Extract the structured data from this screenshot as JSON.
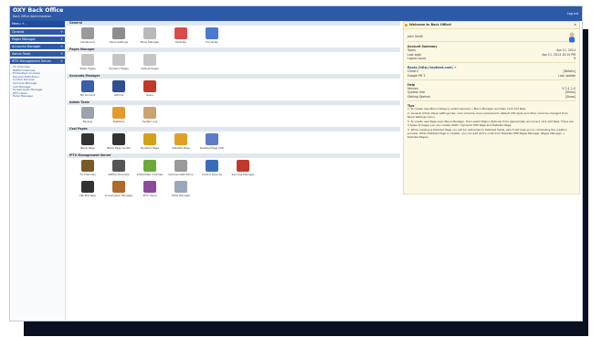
{
  "app": {
    "title": "OXY Back Office",
    "subtitle": "Back Office Administration",
    "logout": "Log out"
  },
  "sidebar": {
    "home": "Menu  + -",
    "sections": [
      {
        "label": "General"
      },
      {
        "label": "Pages Manager"
      },
      {
        "label": "Accounts Manager"
      },
      {
        "label": "Admin Tools"
      },
      {
        "label": "IPTV Management Server"
      }
    ],
    "subitems": [
      "TV Channels",
      "RADIO Channels",
      "Embedded modules",
      "Devices Definitions",
      "Control Devices",
      "Services Manager",
      "Call Manager",
      "Screensaver Manager",
      "IPTV Users",
      "Hotel Manager"
    ]
  },
  "groups": [
    {
      "title": "General",
      "items": [
        {
          "label": "Dashboard",
          "icon": "house-icon",
          "color": "#9a9a9a"
        },
        {
          "label": "Panel Settings",
          "icon": "settings-icon",
          "color": "#8d8d8d"
        },
        {
          "label": "Menu Manager",
          "icon": "menu-icon",
          "color": "#b9b9b9"
        },
        {
          "label": "Modules",
          "icon": "modules-icon",
          "color": "#d94b4b"
        },
        {
          "label": "Countries",
          "icon": "globe-icon",
          "color": "#4a7bd0"
        }
      ]
    },
    {
      "title": "Pages Manager",
      "items": [
        {
          "label": "Static Pages",
          "icon": "page-icon",
          "color": "#c5c5c5"
        },
        {
          "label": "Dynamic Pages",
          "icon": "page-icon",
          "color": "#c5c5c5"
        },
        {
          "label": "Default Pages",
          "icon": "page-icon",
          "color": "#c5c5c5"
        }
      ]
    },
    {
      "title": "Accounts Manager",
      "items": [
        {
          "label": "My Account",
          "icon": "user-icon",
          "color": "#3b5fa8"
        },
        {
          "label": "Admins",
          "icon": "admin-icon",
          "color": "#2f4f8f"
        },
        {
          "label": "Users",
          "icon": "users-icon",
          "color": "#c0392b"
        }
      ]
    },
    {
      "title": "Admin Tools",
      "items": [
        {
          "label": "Backup",
          "icon": "database-icon",
          "color": "#9aa3ad"
        },
        {
          "label": "Statistics",
          "icon": "chart-icon",
          "color": "#e39b2d"
        },
        {
          "label": "System Log",
          "icon": "log-icon",
          "color": "#c9a46e"
        }
      ]
    },
    {
      "title": "Cool Pages",
      "items": [
        {
          "label": "Blank Page",
          "icon": "trash-icon",
          "color": "#333333"
        },
        {
          "label": "Blank Page (Lintb)",
          "icon": "trash-icon",
          "color": "#333333"
        },
        {
          "label": "Dynamic Page",
          "icon": "bell-icon",
          "color": "#d4a017"
        },
        {
          "label": "Detailed Page",
          "icon": "pen-icon",
          "color": "#e0a020"
        },
        {
          "label": "Detailed Page (Alt)",
          "icon": "disk-icon",
          "color": "#5b7bc4"
        }
      ]
    },
    {
      "title": "IPTV Management Server",
      "items": [
        {
          "label": "TV Channels",
          "icon": "tv-icon",
          "color": "#7a5a2a"
        },
        {
          "label": "RADIO Channels",
          "icon": "radio-icon",
          "color": "#555555"
        },
        {
          "label": "Embedded modules",
          "icon": "puzzle-icon",
          "color": "#6ca83a"
        },
        {
          "label": "Devices Definitions",
          "icon": "devices-icon",
          "color": "#9a9a9a"
        },
        {
          "label": "Control Devices",
          "icon": "satellite-icon",
          "color": "#3a6db8"
        },
        {
          "label": "Services Manager",
          "icon": "cube-icon",
          "color": "#c0392b"
        },
        {
          "label": "Call Manager",
          "icon": "phone-icon",
          "color": "#333333"
        },
        {
          "label": "Screensaver Manager",
          "icon": "screen-icon",
          "color": "#b06a2a"
        },
        {
          "label": "IPTV Users",
          "icon": "users-icon",
          "color": "#8a4c9a"
        },
        {
          "label": "Hotel Manager",
          "icon": "hotel-icon",
          "color": "#9aa8b8"
        }
      ]
    }
  ],
  "welcome": {
    "title": "Welcome to Back Office!",
    "close": "×",
    "user": "John Smith",
    "summary_title": "Account Summary",
    "summary": [
      {
        "k": "Today",
        "v": "Apr 11, 2014"
      },
      {
        "k": "Last login",
        "v": "Apr 11, 2014 10:15 PM"
      },
      {
        "k": "Logins count",
        "v": "9"
      }
    ],
    "books_title": "Books (http://oxybook.com) ↗",
    "books": [
      {
        "k": "Cheat Ii",
        "v": "[Details]"
      },
      {
        "k": "Google PR 3",
        "v": "Last update"
      }
    ],
    "help_title": "Help",
    "help": [
      {
        "k": "Version",
        "v": "3.7.4_1.0"
      },
      {
        "k": "System Info",
        "v": "[Show]"
      },
      {
        "k": "Getting Started",
        "v": "[Show]"
      }
    ],
    "tips_title": "Tips",
    "tips": [
      "1. To create new Menu Category select General → Menu Manager and then click Add New.",
      "2. General Admin Panel settings like: color schema, menu placement, default CSS style and other could be changed from Panel Settings menu.",
      "3. To create new Page open Menu Manager, then select [Menu Options] from appropriate record and click Add New. There are 3 types of pages you can create: Static, Dynamic PHP Page and Detailed Page.",
      "4. While creating a Detailed Page you will be redirected to Detailed Fields, which will help you in completing the creation process. When Detailed Page is created, you can edit all it's code from Detailed PHP Pages Manager (Pages Manager → Detailed Pages)."
    ]
  }
}
